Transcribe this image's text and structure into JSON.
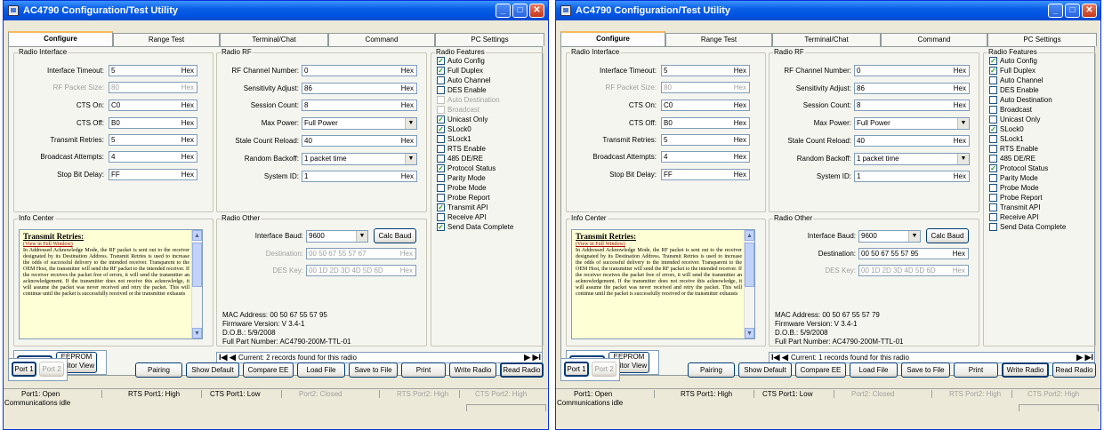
{
  "windows": [
    {
      "title": "AC4790 Configuration/Test Utility",
      "tabs": [
        "Configure",
        "Range Test",
        "Terminal/Chat",
        "Command",
        "PC Settings"
      ],
      "radio_interface": {
        "label": "Radio Interface",
        "fields": [
          {
            "label": "Interface Timeout:",
            "value": "5",
            "unit": "Hex"
          },
          {
            "label": "RF Packet Size:",
            "value": "80",
            "unit": "Hex"
          },
          {
            "label": "CTS On:",
            "value": "C0",
            "unit": "Hex"
          },
          {
            "label": "CTS Off:",
            "value": "B0",
            "unit": "Hex"
          },
          {
            "label": "Transmit Retries:",
            "value": "5",
            "unit": "Hex"
          },
          {
            "label": "Broadcast Attempts:",
            "value": "4",
            "unit": "Hex"
          },
          {
            "label": "Stop Bit Delay:",
            "value": "FF",
            "unit": "Hex"
          }
        ]
      },
      "radio_rf": {
        "label": "Radio RF",
        "channel": {
          "label": "RF Channel Number:",
          "value": "0",
          "unit": "Hex"
        },
        "sensitivity": {
          "label": "Sensitivity Adjust:",
          "value": "86",
          "unit": "Hex"
        },
        "session": {
          "label": "Session Count:",
          "value": "8",
          "unit": "Hex"
        },
        "max_power": {
          "label": "Max Power:",
          "value": "Full Power"
        },
        "stale": {
          "label": "Stale Count Reload:",
          "value": "40",
          "unit": "Hex"
        },
        "backoff": {
          "label": "Random Backoff:",
          "value": "1 packet time"
        },
        "system_id": {
          "label": "System ID:",
          "value": "1",
          "unit": "Hex"
        }
      },
      "radio_features": {
        "label": "Radio Features",
        "items": [
          {
            "label": "Auto Config",
            "mark": "✓"
          },
          {
            "label": "Full Duplex",
            "mark": "✓"
          },
          {
            "label": "Auto Channel",
            "mark": ""
          },
          {
            "label": "DES Enable",
            "mark": ""
          },
          {
            "label": "Auto Destination",
            "mark": ""
          },
          {
            "label": "Broadcast",
            "mark": ""
          },
          {
            "label": "Unicast Only",
            "mark": "✓"
          },
          {
            "label": "SLock0",
            "mark": "✓"
          },
          {
            "label": "SLock1",
            "mark": ""
          },
          {
            "label": "RTS Enable",
            "mark": ""
          },
          {
            "label": "485 DE/RE",
            "mark": ""
          },
          {
            "label": "Protocol Status",
            "mark": "✓"
          },
          {
            "label": "Parity Mode",
            "mark": ""
          },
          {
            "label": "Probe Mode",
            "mark": ""
          },
          {
            "label": "Probe Report",
            "mark": ""
          },
          {
            "label": "Transmit API",
            "mark": "✓"
          },
          {
            "label": "Receive API",
            "mark": ""
          },
          {
            "label": "Send Data Complete",
            "mark": "✓"
          }
        ]
      },
      "info_center": {
        "label": "Info Center",
        "heading": "Transmit Retries:",
        "link": "(View in Full Window)",
        "body": "In Addressed Acknowledge Mode, the RF packet is sent out to the receiver designated by its Destination Address. Transmit Retries is used to increase the odds of successful delivery to the intended receiver. Transparent to the OEM Host, the transmitter will send the RF packet to the intended receiver. If the receiver receives the packet free of errors, it will send the transmitter an acknowledgement. If the transmitter does not receive this acknowledge, it will assume the packet was never received and retry the packet. This will continue until the packet is successfully received or the transmitter exhausts"
      },
      "radio_other": {
        "label": "Radio Other",
        "baud_label": "Interface Baud:",
        "baud": "9600",
        "calc_label": "Calc Baud",
        "dest_label": "Destination:",
        "dest": "00 50 67 55 57 67",
        "des_label": "DES Key:",
        "des": "00 1D 2D 3D 4D 5D 6D",
        "unit": "Hex",
        "mac": "MAC Address:  00 50 67 55 57 95",
        "fw": "Firmware Version:  V 3.4-1",
        "dob": "D.O.B.:  5/9/2008",
        "part": "Full Part Number:  AC4790-200M-TTL-01"
      },
      "views": {
        "gui": "GUI View",
        "eeprom": "EEPROM Editor View"
      },
      "nav": {
        "first": "I◀",
        "prev": "◀",
        "text": "Current:  2 records found for this radio",
        "next": "▶",
        "last": "▶I"
      },
      "ports": {
        "p1": "Port 1",
        "p2": "Port 2"
      },
      "buttons": [
        "Pairing",
        "Show Default",
        "Compare EE",
        "Load File",
        "Save to File",
        "Print",
        "Write Radio",
        "Read Radio"
      ],
      "status": [
        "Port1: Open",
        "RTS Port1: High",
        "CTS Port1: Low",
        "Port2: Closed",
        "RTS Port2: High",
        "CTS Port2: High"
      ],
      "message": "Communications idle"
    },
    {
      "title": "AC4790 Configuration/Test Utility",
      "tabs": [
        "Configure",
        "Range Test",
        "Terminal/Chat",
        "Command",
        "PC Settings"
      ],
      "radio_interface": {
        "label": "Radio Interface",
        "fields": [
          {
            "label": "Interface Timeout:",
            "value": "5",
            "unit": "Hex"
          },
          {
            "label": "RF Packet Size:",
            "value": "80",
            "unit": "Hex"
          },
          {
            "label": "CTS On:",
            "value": "C0",
            "unit": "Hex"
          },
          {
            "label": "CTS Off:",
            "value": "B0",
            "unit": "Hex"
          },
          {
            "label": "Transmit Retries:",
            "value": "5",
            "unit": "Hex"
          },
          {
            "label": "Broadcast Attempts:",
            "value": "4",
            "unit": "Hex"
          },
          {
            "label": "Stop Bit Delay:",
            "value": "FF",
            "unit": "Hex"
          }
        ]
      },
      "radio_rf": {
        "label": "Radio RF",
        "channel": {
          "label": "RF Channel Number:",
          "value": "0",
          "unit": "Hex"
        },
        "sensitivity": {
          "label": "Sensitivity Adjust:",
          "value": "86",
          "unit": "Hex"
        },
        "session": {
          "label": "Session Count:",
          "value": "8",
          "unit": "Hex"
        },
        "max_power": {
          "label": "Max Power:",
          "value": "Full Power"
        },
        "stale": {
          "label": "Stale Count Reload:",
          "value": "40",
          "unit": "Hex"
        },
        "backoff": {
          "label": "Random Backoff:",
          "value": "1 packet time"
        },
        "system_id": {
          "label": "System ID:",
          "value": "1",
          "unit": "Hex"
        }
      },
      "radio_features": {
        "label": "Radio Features",
        "items": [
          {
            "label": "Auto Config",
            "mark": "✓"
          },
          {
            "label": "Full Duplex",
            "mark": "✓"
          },
          {
            "label": "Auto Channel",
            "mark": ""
          },
          {
            "label": "DES Enable",
            "mark": ""
          },
          {
            "label": "Auto Destination",
            "mark": ""
          },
          {
            "label": "Broadcast",
            "mark": ""
          },
          {
            "label": "Unicast Only",
            "mark": ""
          },
          {
            "label": "SLock0",
            "mark": "✓"
          },
          {
            "label": "SLock1",
            "mark": ""
          },
          {
            "label": "RTS Enable",
            "mark": ""
          },
          {
            "label": "485 DE/RE",
            "mark": ""
          },
          {
            "label": "Protocol Status",
            "mark": "✓"
          },
          {
            "label": "Parity Mode",
            "mark": ""
          },
          {
            "label": "Probe Mode",
            "mark": ""
          },
          {
            "label": "Probe Report",
            "mark": ""
          },
          {
            "label": "Transmit API",
            "mark": ""
          },
          {
            "label": "Receive API",
            "mark": ""
          },
          {
            "label": "Send Data Complete",
            "mark": ""
          }
        ]
      },
      "info_center": {
        "label": "Info Center",
        "heading": "Transmit Retries:",
        "link": "(View in Full Window)",
        "body": "In Addressed Acknowledge Mode, the RF packet is sent out to the receiver designated by its Destination Address. Transmit Retries is used to increase the odds of successful delivery to the intended receiver. Transparent to the OEM Host, the transmitter will send the RF packet to the intended receiver. If the receiver receives the packet free of errors, it will send the transmitter an acknowledgement. If the transmitter does not receive this acknowledge, it will assume the packet was never received and retry the packet. This will continue until the packet is successfully received or the transmitter exhausts"
      },
      "radio_other": {
        "label": "Radio Other",
        "baud_label": "Interface Baud:",
        "baud": "9600",
        "calc_label": "Calc Baud",
        "dest_label": "Destination:",
        "dest": "00 50 67 55 57 95",
        "des_label": "DES Key:",
        "des": "00 1D 2D 3D 4D 5D 6D",
        "unit": "Hex",
        "mac": "MAC Address:  00 50 67 55 57 79",
        "fw": "Firmware Version:  V 3.4-1",
        "dob": "D.O.B.:  5/9/2008",
        "part": "Full Part Number:  AC4790-200M-TTL-01"
      },
      "views": {
        "gui": "GUI View",
        "eeprom": "EEPROM Editor View"
      },
      "nav": {
        "first": "I◀",
        "prev": "◀",
        "text": "Current:  1 records found for this radio",
        "next": "▶",
        "last": "▶I"
      },
      "ports": {
        "p1": "Port 1",
        "p2": "Port 2"
      },
      "buttons": [
        "Pairing",
        "Show Default",
        "Compare EE",
        "Load File",
        "Save to File",
        "Print",
        "Write Radio",
        "Read Radio"
      ],
      "status": [
        "Port1: Open",
        "RTS Port1: High",
        "CTS Port1: Low",
        "Port2: Closed",
        "RTS Port2: High",
        "CTS Port2: High"
      ],
      "message": "Communications idle"
    }
  ]
}
